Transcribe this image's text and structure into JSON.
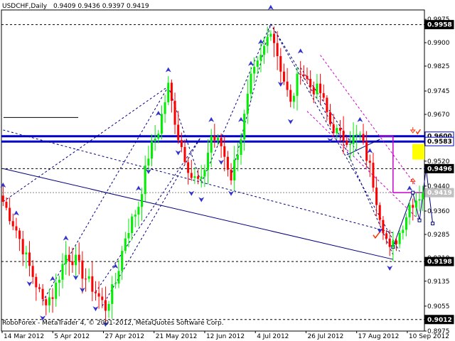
{
  "header": {
    "symbol": "USDCHF,Daily",
    "ohlc": "0.9409 0.9436 0.9397 0.9419"
  },
  "footer": {
    "copyright": "RoboForex - MetaTrader 4, © 2001-2012, MetaQuotes Software Corp."
  },
  "colors": {
    "bull": "#00ee00",
    "bear": "#ff0000",
    "pattern": "#000080",
    "wedge": "#cc00cc",
    "level": "#0000cc",
    "highlight": "#ffff00",
    "marker": "#ff3300"
  },
  "chart_data": {
    "type": "candlestick",
    "ylim": [
      0.8975,
      1.0005
    ],
    "x_tick_labels": [
      "14 Mar 2012",
      "5 Apr 2012",
      "27 Apr 2012",
      "21 May 2012",
      "12 Jun 2012",
      "4 Jul 2012",
      "26 Jul 2012",
      "17 Aug 2012",
      "10 Sep 2012"
    ],
    "y_ticks": [
      0.9975,
      0.99,
      0.9825,
      0.9745,
      0.967,
      0.9595,
      0.952,
      0.944,
      0.936,
      0.9285,
      0.921,
      0.9135,
      0.9055,
      0.8975
    ],
    "levels": [
      {
        "label": "0.9958",
        "value": 0.9958,
        "style": "dashed-black",
        "boxed": true
      },
      {
        "label": "0.9600",
        "value": 0.96,
        "style": "blue-thick",
        "boxed": true
      },
      {
        "label": "0.9583",
        "value": 0.9583,
        "style": "blue-thick",
        "boxed": true
      },
      {
        "label": "0.9496",
        "value": 0.9496,
        "style": "dashed-black",
        "boxed": true
      },
      {
        "label": "0.9419",
        "value": 0.9419,
        "style": "gray-dashed",
        "boxed": true
      },
      {
        "label": "0.9198",
        "value": 0.9198,
        "style": "dashed-black",
        "boxed": true
      },
      {
        "label": "0.9012",
        "value": 0.9012,
        "style": "dashed-black",
        "boxed": true
      }
    ],
    "keypoints": [
      [
        0,
        0.939
      ],
      [
        4,
        0.93
      ],
      [
        8,
        0.918
      ],
      [
        12,
        0.907
      ],
      [
        15,
        0.909
      ],
      [
        19,
        0.922
      ],
      [
        22,
        0.92
      ],
      [
        24,
        0.916
      ],
      [
        28,
        0.91
      ],
      [
        31,
        0.905
      ],
      [
        34,
        0.913
      ],
      [
        37,
        0.928
      ],
      [
        41,
        0.938
      ],
      [
        44,
        0.954
      ],
      [
        47,
        0.962
      ],
      [
        50,
        0.976
      ],
      [
        53,
        0.96
      ],
      [
        57,
        0.947
      ],
      [
        60,
        0.945
      ],
      [
        63,
        0.96
      ],
      [
        66,
        0.957
      ],
      [
        69,
        0.947
      ],
      [
        72,
        0.96
      ],
      [
        75,
        0.978
      ],
      [
        78,
        0.985
      ],
      [
        81,
        0.995
      ],
      [
        84,
        0.982
      ],
      [
        87,
        0.97
      ],
      [
        90,
        0.982
      ],
      [
        93,
        0.976
      ],
      [
        96,
        0.974
      ],
      [
        99,
        0.964
      ],
      [
        102,
        0.96
      ],
      [
        105,
        0.959
      ],
      [
        108,
        0.96
      ],
      [
        111,
        0.95
      ],
      [
        114,
        0.935
      ],
      [
        117,
        0.923
      ],
      [
        120,
        0.929
      ],
      [
        123,
        0.938
      ],
      [
        126,
        0.941
      ],
      [
        127,
        0.9419
      ]
    ]
  }
}
